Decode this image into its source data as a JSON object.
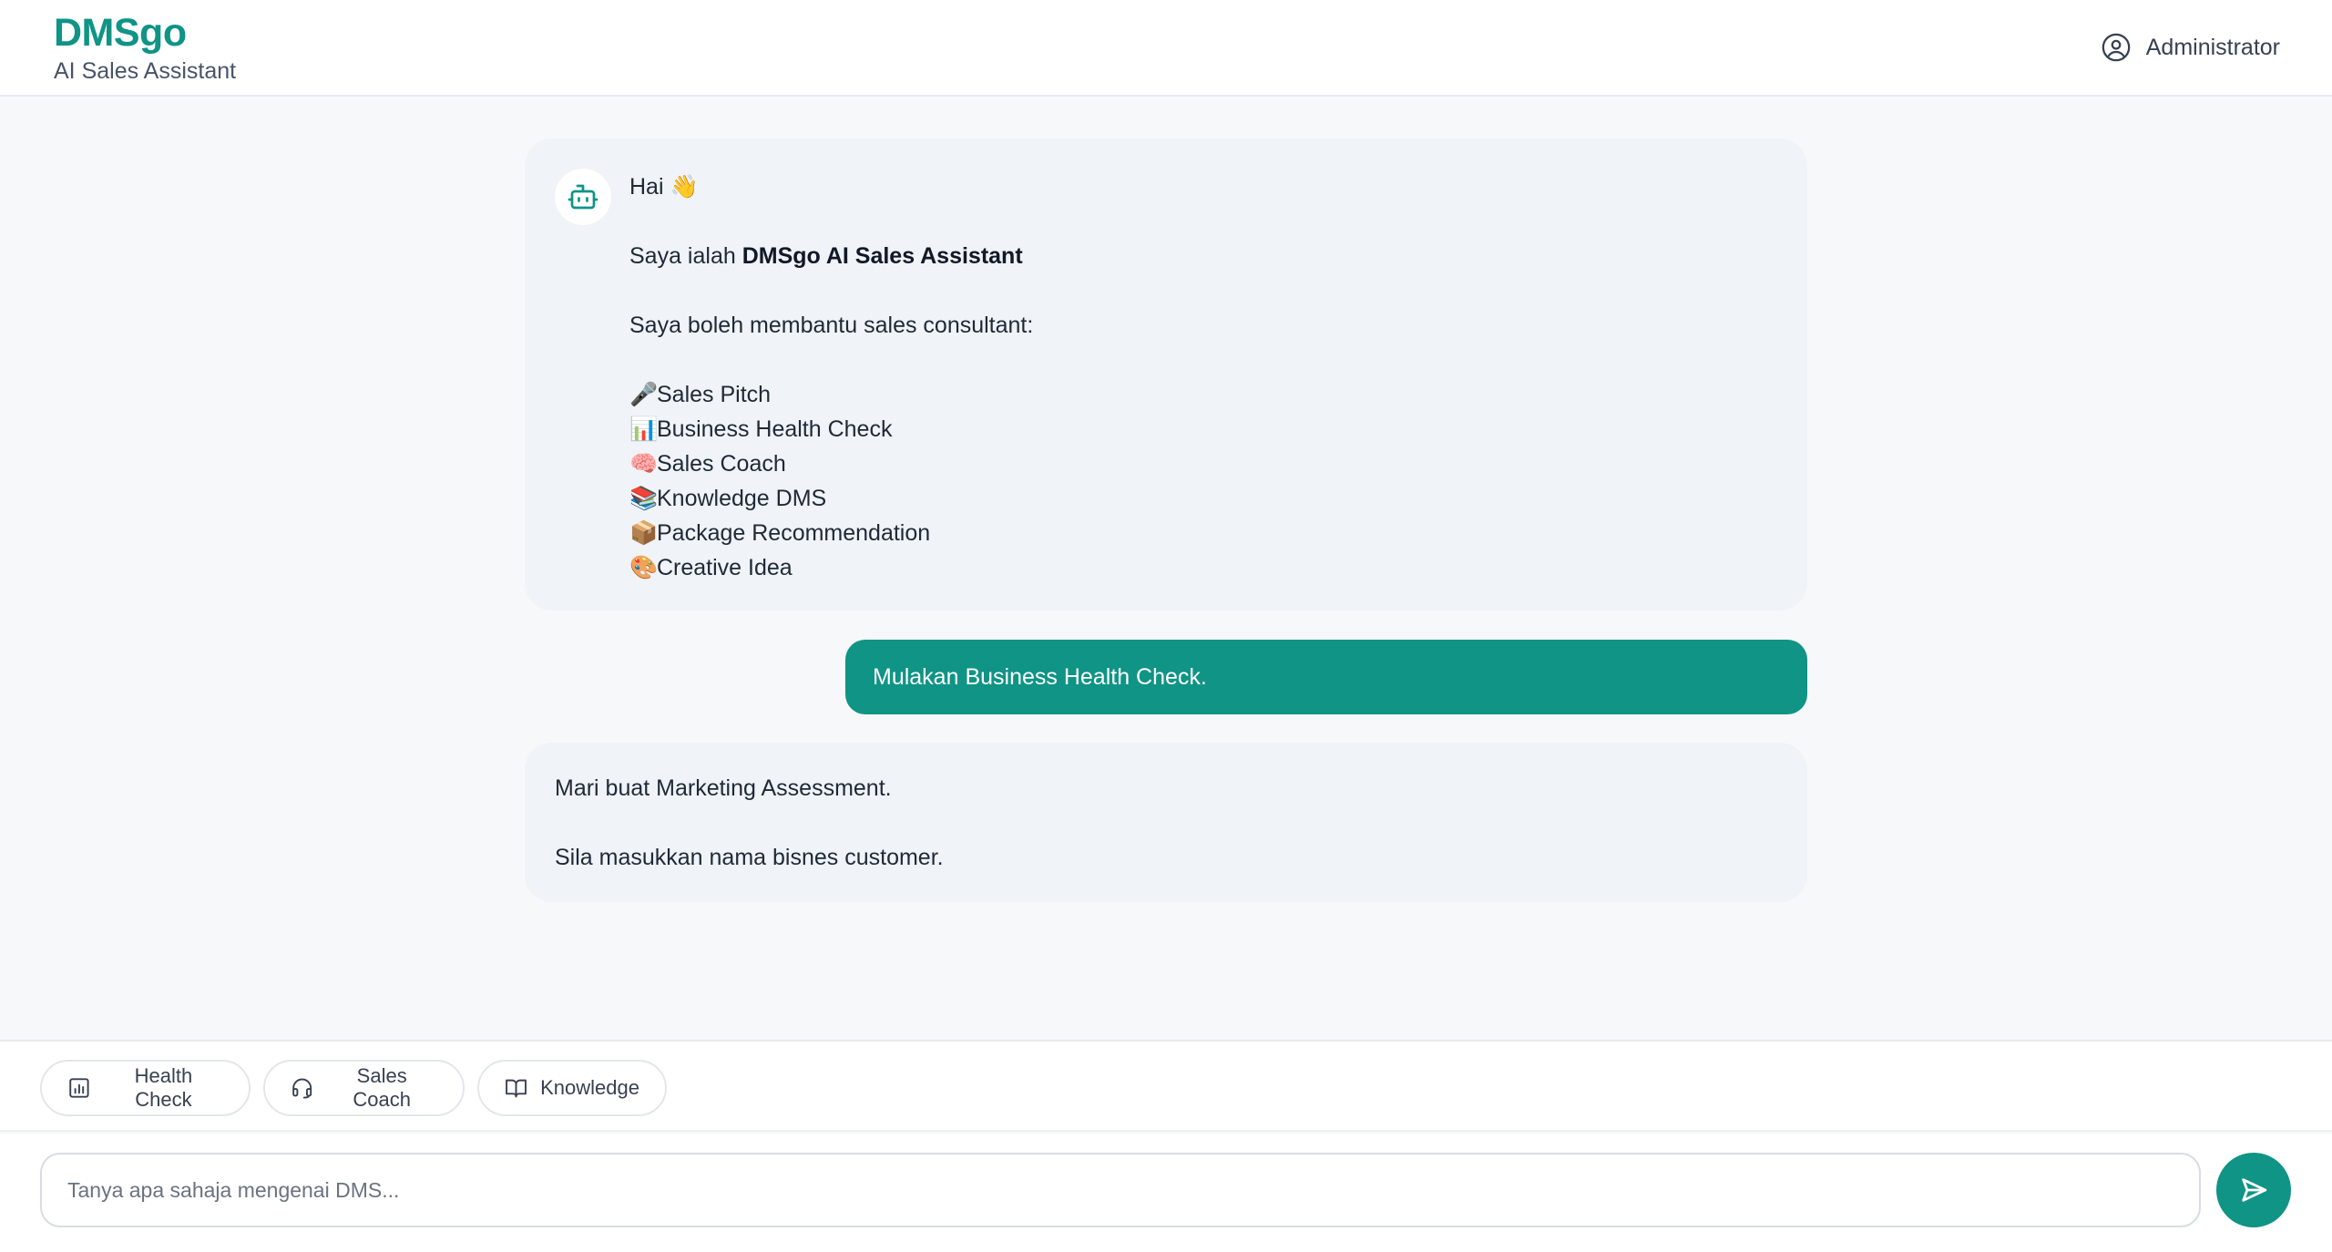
{
  "header": {
    "brand": "DMSgo",
    "subtitle": "AI Sales Assistant",
    "user_name": "Administrator"
  },
  "colors": {
    "accent": "#0f9486",
    "bot_bubble": "#f0f3f7",
    "background": "#f7f8fa"
  },
  "chat": {
    "welcome": {
      "greeting": "Hai",
      "greeting_emoji": "👋",
      "intro_prefix": "Saya ialah ",
      "intro_bold": "DMSgo AI Sales Assistant",
      "capabilities_intro": "Saya boleh membantu sales consultant:",
      "capabilities": [
        {
          "emoji": "🎤",
          "label": "Sales Pitch"
        },
        {
          "emoji": "📊",
          "label": "Business Health Check"
        },
        {
          "emoji": "🧠",
          "label": "Sales Coach"
        },
        {
          "emoji": "📚",
          "label": "Knowledge DMS"
        },
        {
          "emoji": "📦",
          "label": "Package Recommendation"
        },
        {
          "emoji": "🎨",
          "label": "Creative Idea"
        }
      ]
    },
    "user_message": "Mulakan Business Health Check.",
    "bot_reply": {
      "line1": "Mari buat Marketing Assessment.",
      "line2": "Sila masukkan nama bisnes customer."
    }
  },
  "quick_actions": [
    {
      "label": "Health Check",
      "icon": "bar-chart-icon"
    },
    {
      "label": "Sales Coach",
      "icon": "headset-icon"
    },
    {
      "label": "Knowledge",
      "icon": "book-open-icon"
    }
  ],
  "composer": {
    "placeholder": "Tanya apa sahaja mengenai DMS...",
    "send_icon": "send-icon"
  }
}
